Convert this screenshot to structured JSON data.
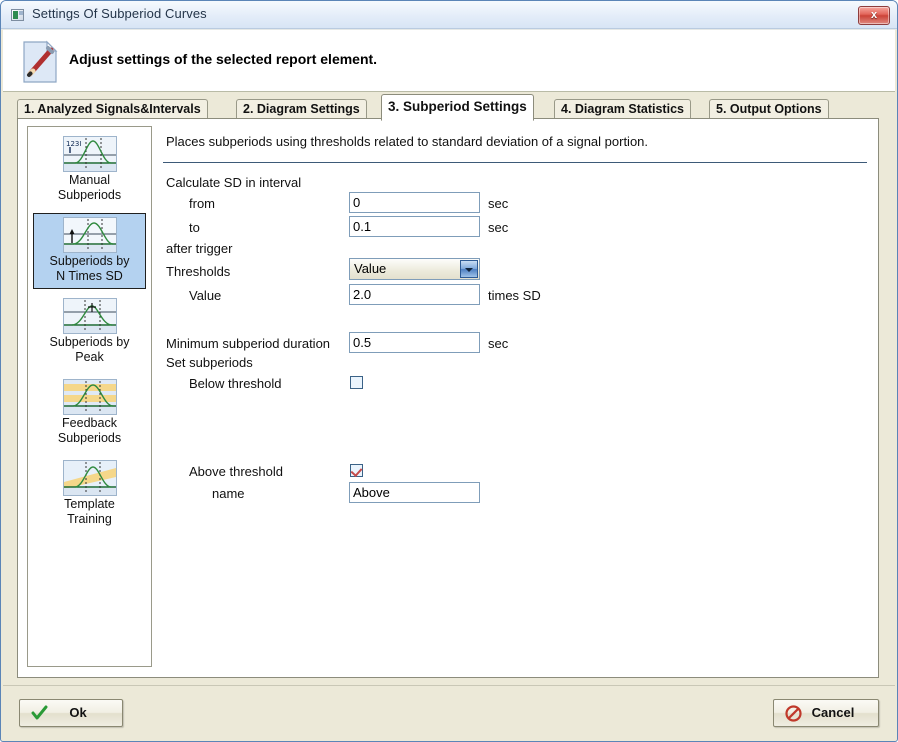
{
  "window": {
    "title": "Settings Of Subperiod Curves",
    "close_label": "x",
    "icon": "window-app-icon"
  },
  "header": {
    "icon": "document-pencil-icon",
    "title": "Adjust settings of the selected report element."
  },
  "tabs": [
    {
      "label": "1. Analyzed Signals&Intervals",
      "active": false
    },
    {
      "label": "2. Diagram Settings",
      "active": false
    },
    {
      "label": "3. Subperiod Settings",
      "active": true
    },
    {
      "label": "4. Diagram Statistics",
      "active": false
    },
    {
      "label": "5. Output Options",
      "active": false
    }
  ],
  "sidebar": {
    "items": [
      {
        "label_line1": "Manual",
        "label_line2": "Subperiods",
        "icon": "manual-subperiods-thumb",
        "selected": false
      },
      {
        "label_line1": "Subperiods by",
        "label_line2": "N Times SD",
        "icon": "subperiods-by-n-times-sd-thumb",
        "selected": true
      },
      {
        "label_line1": "Subperiods by",
        "label_line2": "Peak",
        "icon": "subperiods-by-peak-thumb",
        "selected": false
      },
      {
        "label_line1": "Feedback",
        "label_line2": "Subperiods",
        "icon": "feedback-subperiods-thumb",
        "selected": false
      },
      {
        "label_line1": "Template",
        "label_line2": "Training",
        "icon": "template-training-thumb",
        "selected": false
      }
    ]
  },
  "form": {
    "intro": "Places subperiods using thresholds related to standard deviation of a signal portion.",
    "calculate_sd_label": "Calculate SD in interval",
    "from_label": "from",
    "from_value": "0",
    "from_unit": "sec",
    "to_label": "to",
    "to_value": "0.1",
    "to_unit": "sec",
    "after_trigger_label": "after trigger",
    "thresholds_label": "Thresholds",
    "thresholds_value": "Value",
    "value_label": "Value",
    "value_value": "2.0",
    "value_unit": "times SD",
    "min_duration_label": "Minimum subperiod duration",
    "min_duration_value": "0.5",
    "min_duration_unit": "sec",
    "set_subperiods_label": "Set subperiods",
    "below_threshold_label": "Below threshold",
    "below_threshold_checked": false,
    "above_threshold_label": "Above threshold",
    "above_threshold_checked": true,
    "name_label": "name",
    "name_value": "Above"
  },
  "buttons": {
    "ok_label": "Ok",
    "ok_icon": "green-check-icon",
    "cancel_label": "Cancel",
    "cancel_icon": "red-forbidden-icon"
  },
  "colors": {
    "titlebar": "#e4edf9",
    "dialog_face": "#ece9d8",
    "selection": "#b4d2f0",
    "accent_border": "#7f9db9",
    "close_red": "#cc4338",
    "ok_green": "#2a9a36",
    "cancel_red": "#c0392b"
  }
}
